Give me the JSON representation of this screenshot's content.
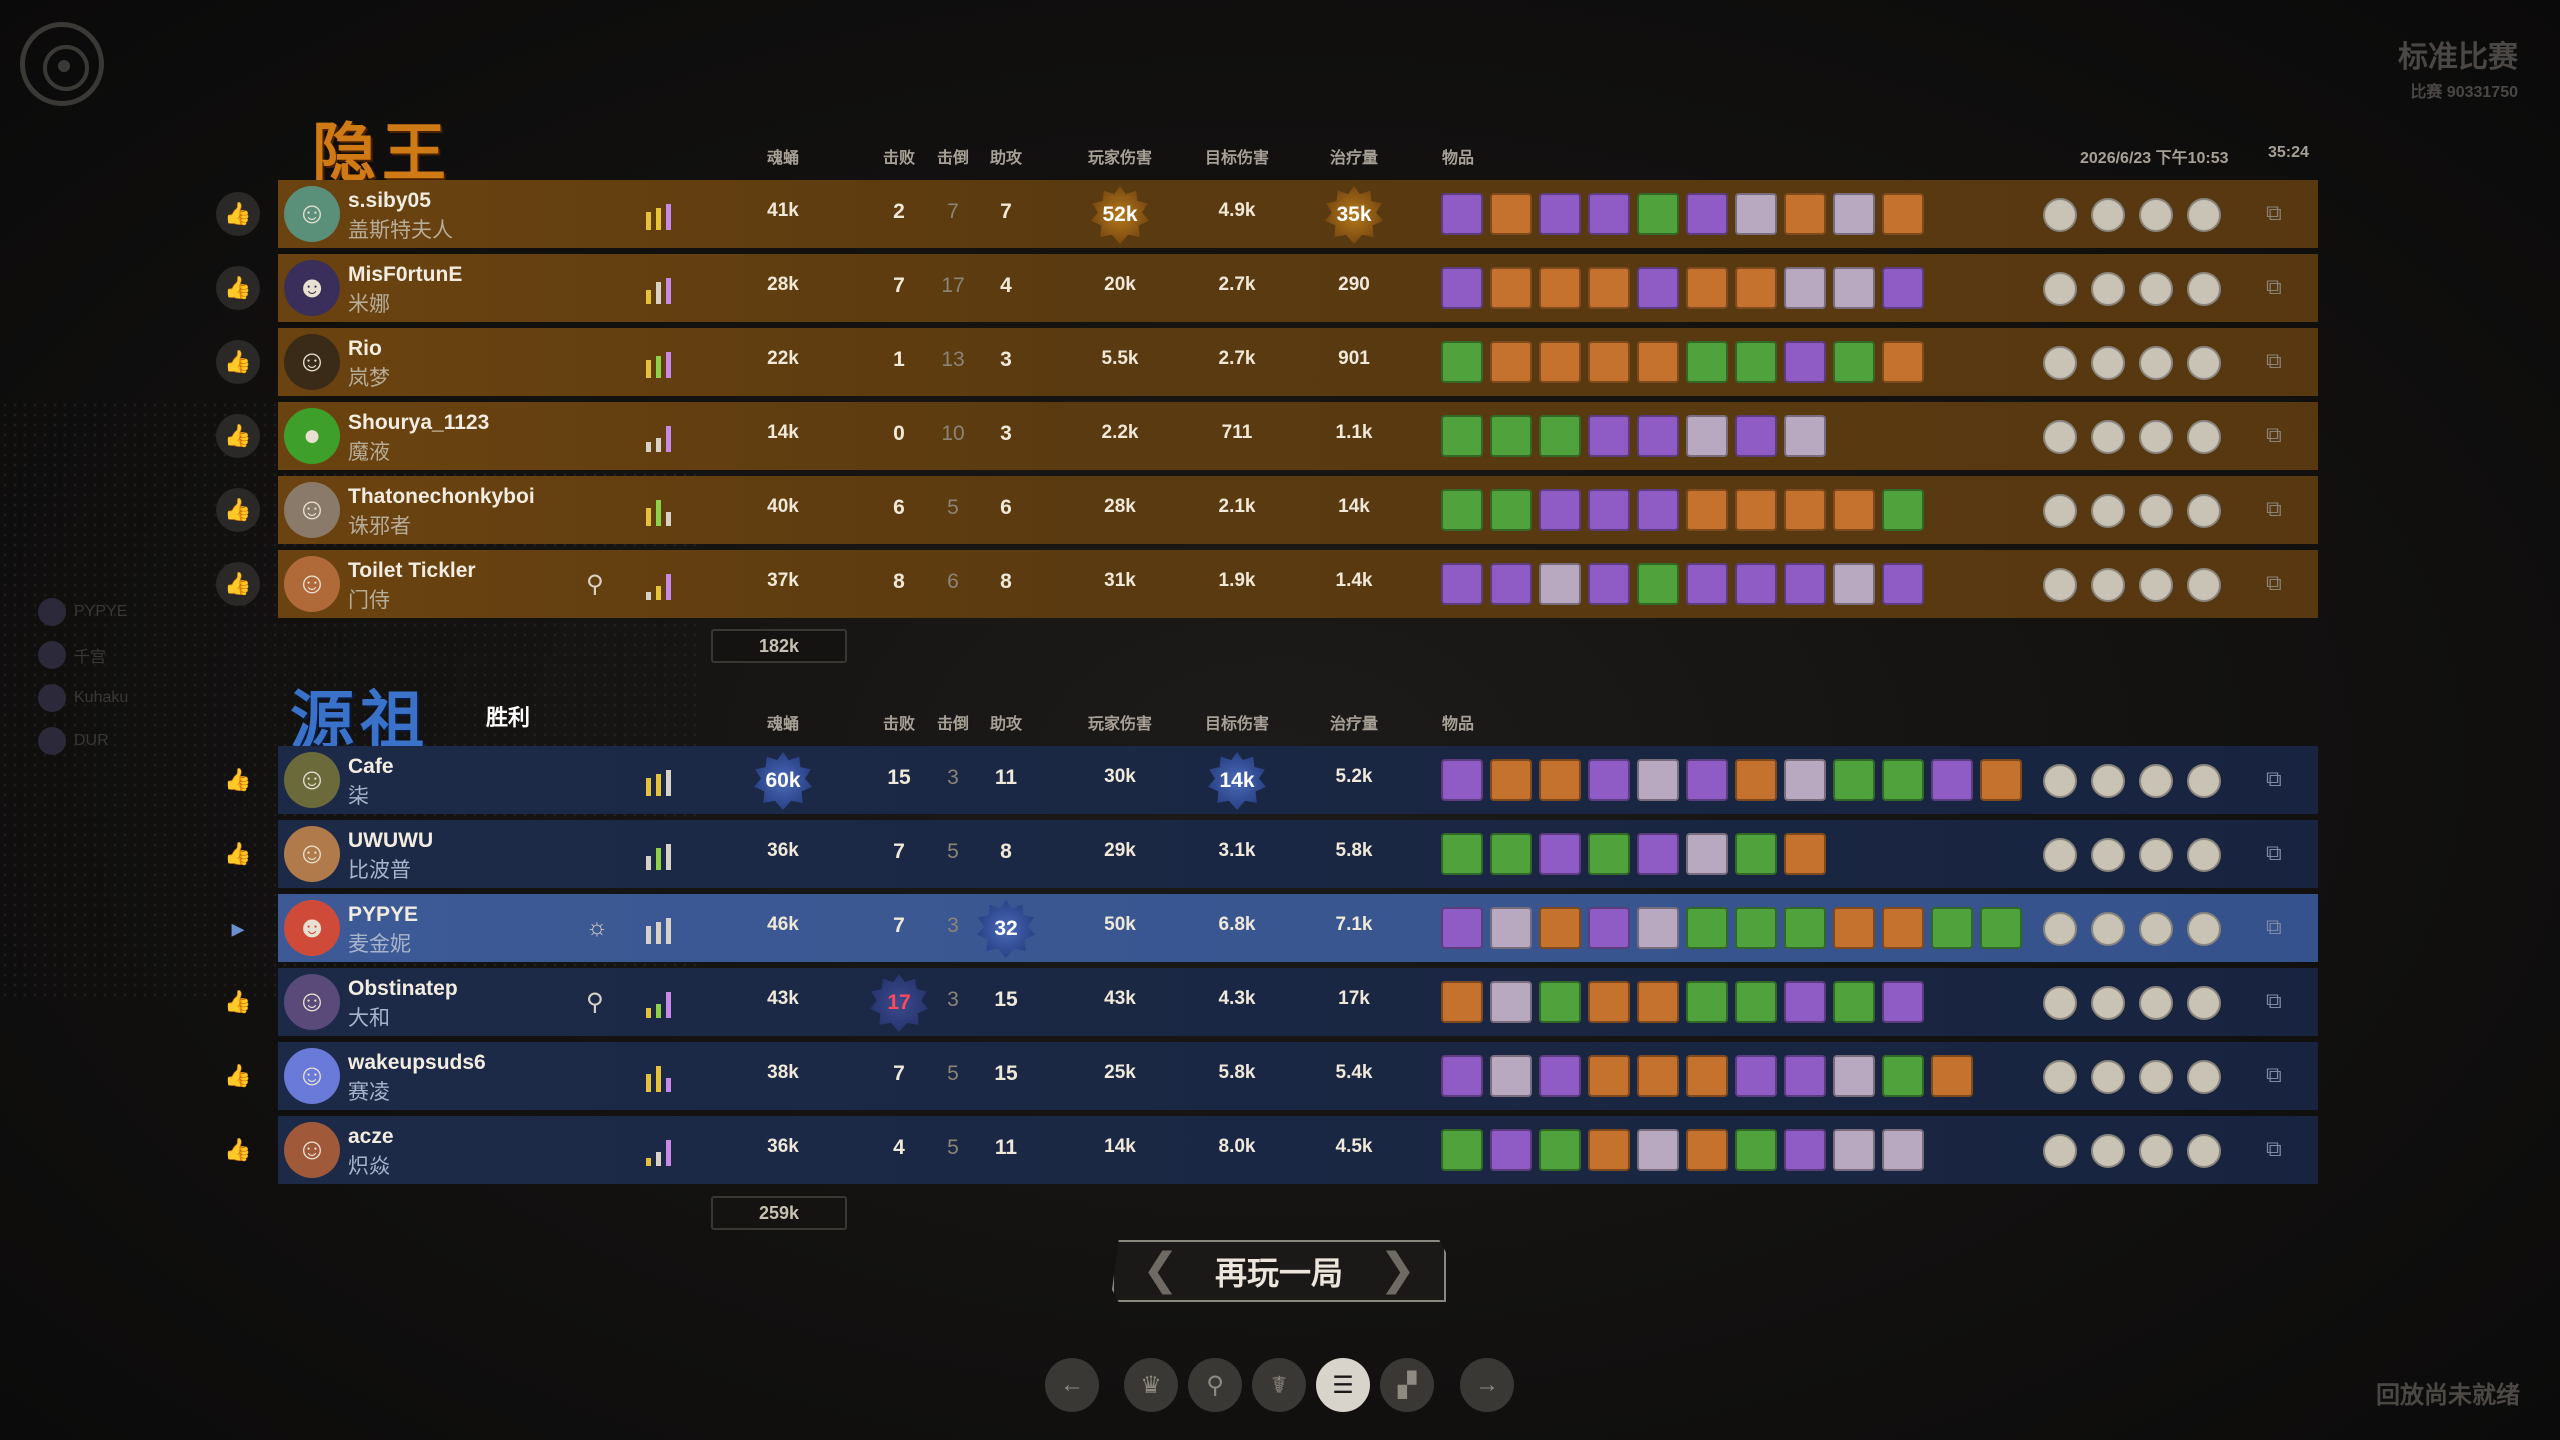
{
  "match": {
    "mode": "标准比赛",
    "id": "比赛 90331750",
    "datetime": "2026/6/23 下午10:53",
    "duration": "35:24"
  },
  "headers": {
    "souls": "魂蛹",
    "kills": "击败",
    "deaths": "击倒",
    "assists": "助攻",
    "player_damage": "玩家伤害",
    "objective_damage": "目标伤害",
    "healing": "治疗量",
    "items": "物品"
  },
  "team_hidden": {
    "name": "隐王",
    "total": "182k",
    "players": [
      {
        "player": "s.siby05",
        "hero": "盖斯特夫人",
        "souls": "41k",
        "kills": "2",
        "deaths": "7",
        "assists": "7",
        "player_damage": "52k",
        "objective_damage": "4.9k",
        "healing": "35k"
      },
      {
        "player": "MisF0rtunE",
        "hero": "米娜",
        "souls": "28k",
        "kills": "7",
        "deaths": "17",
        "assists": "4",
        "player_damage": "20k",
        "objective_damage": "2.7k",
        "healing": "290"
      },
      {
        "player": "Rio",
        "hero": "岚梦",
        "souls": "22k",
        "kills": "1",
        "deaths": "13",
        "assists": "3",
        "player_damage": "5.5k",
        "objective_damage": "2.7k",
        "healing": "901"
      },
      {
        "player": "Shourya_1123",
        "hero": "魔液",
        "souls": "14k",
        "kills": "0",
        "deaths": "10",
        "assists": "3",
        "player_damage": "2.2k",
        "objective_damage": "711",
        "healing": "1.1k"
      },
      {
        "player": "Thatonechonkyboi",
        "hero": "诛邪者",
        "souls": "40k",
        "kills": "6",
        "deaths": "5",
        "assists": "6",
        "player_damage": "28k",
        "objective_damage": "2.1k",
        "healing": "14k"
      },
      {
        "player": "Toilet Tickler",
        "hero": "门侍",
        "souls": "37k",
        "kills": "8",
        "deaths": "6",
        "assists": "8",
        "player_damage": "31k",
        "objective_damage": "1.9k",
        "healing": "1.4k"
      }
    ]
  },
  "team_arch": {
    "name": "源祖",
    "result": "胜利",
    "total": "259k",
    "players": [
      {
        "player": "Cafe",
        "hero": "柒",
        "souls": "60k",
        "kills": "15",
        "deaths": "3",
        "assists": "11",
        "player_damage": "30k",
        "objective_damage": "14k",
        "healing": "5.2k"
      },
      {
        "player": "UWUWU",
        "hero": "比波普",
        "souls": "36k",
        "kills": "7",
        "deaths": "5",
        "assists": "8",
        "player_damage": "29k",
        "objective_damage": "3.1k",
        "healing": "5.8k"
      },
      {
        "player": "PYPYE",
        "hero": "麦金妮",
        "souls": "46k",
        "kills": "7",
        "deaths": "3",
        "assists": "32",
        "player_damage": "50k",
        "objective_damage": "6.8k",
        "healing": "7.1k"
      },
      {
        "player": "Obstinatep",
        "hero": "大和",
        "souls": "43k",
        "kills": "17",
        "deaths": "3",
        "assists": "15",
        "player_damage": "43k",
        "objective_damage": "4.3k",
        "healing": "17k"
      },
      {
        "player": "wakeupsuds6",
        "hero": "赛凌",
        "souls": "38k",
        "kills": "7",
        "deaths": "5",
        "assists": "15",
        "player_damage": "25k",
        "objective_damage": "5.8k",
        "healing": "5.4k"
      },
      {
        "player": "acze",
        "hero": "炽焱",
        "souls": "36k",
        "kills": "4",
        "deaths": "5",
        "assists": "11",
        "player_damage": "14k",
        "objective_damage": "8.0k",
        "healing": "4.5k"
      }
    ]
  },
  "side_list": [
    "PYPYE",
    "千宫",
    "Kuhaku",
    "DUR"
  ],
  "actions": {
    "play_again": "再玩一局"
  },
  "replay_status": "回放尚未就绪",
  "icons": {
    "thumb": "thumbs-up-icon",
    "copy": "copy-icon",
    "nav": [
      "prev-arrow-icon",
      "trophy-icon",
      "map-pin-icon",
      "hands-icon",
      "list-icon",
      "chart-icon",
      "next-arrow-icon"
    ]
  }
}
